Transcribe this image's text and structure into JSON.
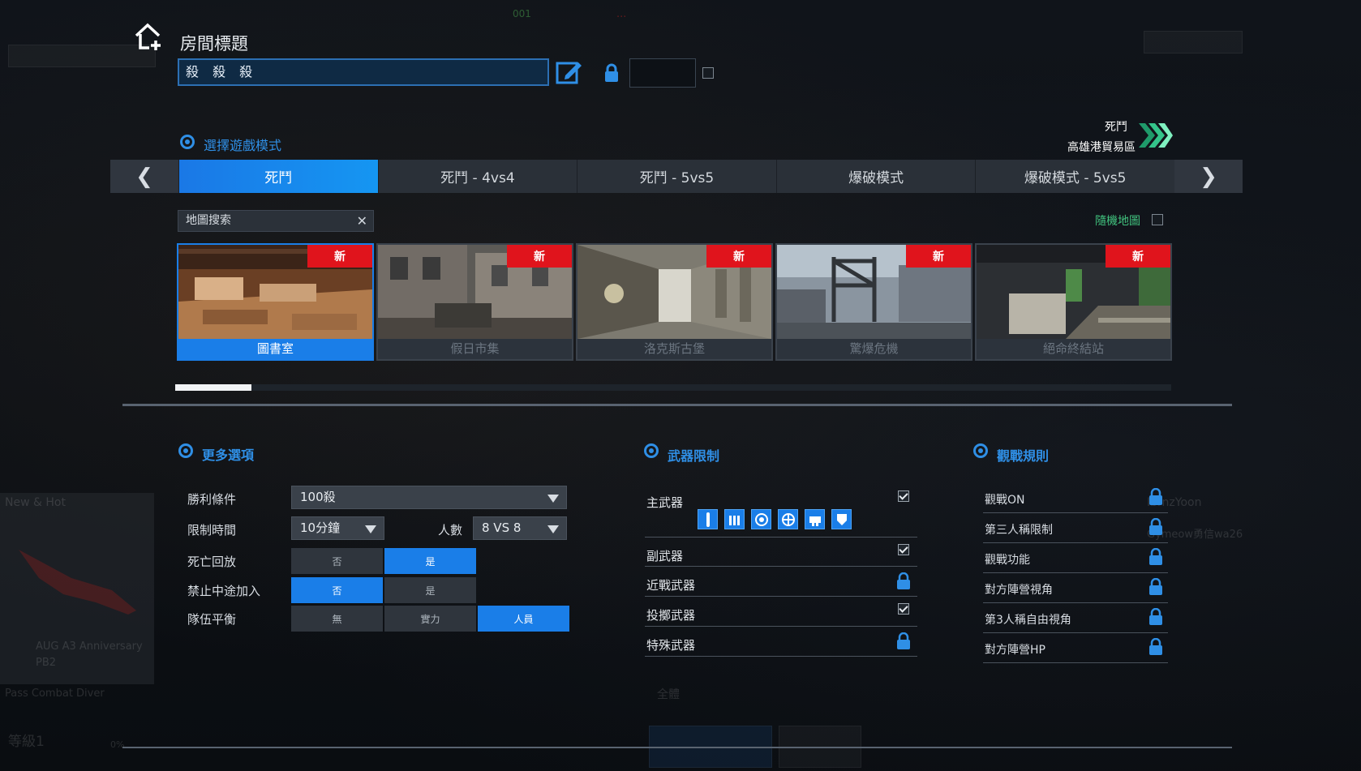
{
  "header": {
    "title": "房間標題",
    "room_name": "殺 殺 殺",
    "password_value": ""
  },
  "mode_section": {
    "heading": "選擇遊戲模式"
  },
  "current_mode": {
    "mode": "死鬥",
    "map": "高雄港貿易區"
  },
  "tabs": [
    {
      "label": "死鬥",
      "active": true
    },
    {
      "label": "死鬥 - 4vs4",
      "active": false
    },
    {
      "label": "死鬥 - 5vs5",
      "active": false
    },
    {
      "label": "爆破模式",
      "active": false
    },
    {
      "label": "爆破模式 - 5vs5",
      "active": false
    }
  ],
  "nav": {
    "prev": "❮",
    "next": "❯"
  },
  "map_search": {
    "placeholder": "地圖搜索",
    "clear": "✕"
  },
  "random_map": {
    "label": "隨機地圖",
    "checked": false
  },
  "maps": [
    {
      "name": "圖書室",
      "badge": "新",
      "selected": true
    },
    {
      "name": "假日市集",
      "badge": "新",
      "selected": false
    },
    {
      "name": "洛克斯古堡",
      "badge": "新",
      "selected": false
    },
    {
      "name": "驚爆危機",
      "badge": "新",
      "selected": false
    },
    {
      "name": "絕命終結站",
      "badge": "新",
      "selected": false
    }
  ],
  "map_scroll": {
    "position_fraction": 0.077
  },
  "more_options": {
    "heading": "更多選項",
    "win_condition": {
      "label": "勝利條件",
      "value": "100殺"
    },
    "time_limit": {
      "label": "限制時間",
      "value": "10分鐘"
    },
    "players": {
      "label": "人數",
      "value": "8 VS 8"
    },
    "death_replay": {
      "label": "死亡回放",
      "options": [
        "否",
        "是"
      ],
      "selected": "是"
    },
    "no_midjoin": {
      "label": "禁止中途加入",
      "options": [
        "否",
        "是"
      ],
      "selected": "否"
    },
    "team_balance": {
      "label": "隊伍平衡",
      "options": [
        "無",
        "實力",
        "人員"
      ],
      "selected": "人員"
    }
  },
  "weapon_limits": {
    "heading": "武器限制",
    "rows": [
      {
        "label": "主武器",
        "state": "checked"
      },
      {
        "label": "副武器",
        "state": "checked"
      },
      {
        "label": "近戰武器",
        "state": "locked"
      },
      {
        "label": "投擲武器",
        "state": "checked"
      },
      {
        "label": "特殊武器",
        "state": "locked"
      }
    ],
    "primary_icons": [
      "sniper-icon",
      "ammo-icon",
      "target-icon",
      "crosshair-icon",
      "smg-icon",
      "shield-icon"
    ]
  },
  "spectator_rules": {
    "heading": "觀戰規則",
    "rows": [
      {
        "label": "觀戰ON"
      },
      {
        "label": "第三人稱限制"
      },
      {
        "label": "觀戰功能"
      },
      {
        "label": "對方陣營視角"
      },
      {
        "label": "第3人稱自由視角"
      },
      {
        "label": "對方陣營HP"
      }
    ]
  },
  "background": {
    "room_label": "001",
    "news": "New & Hot",
    "weapon_name": "AUG A3 Anniversary",
    "weapon_sub": "PB2",
    "pass": "Pass Combat Diver",
    "level": "等級1",
    "percent": "0%",
    "mode_hint": "全體",
    "player1": "IbrnzYoon",
    "player2": "Gymeow勇信wa26"
  },
  "colors": {
    "accent": "#1a7ee8",
    "new_badge": "#e0141c",
    "section": "#2f8fe6",
    "random_label": "#41c27e"
  }
}
